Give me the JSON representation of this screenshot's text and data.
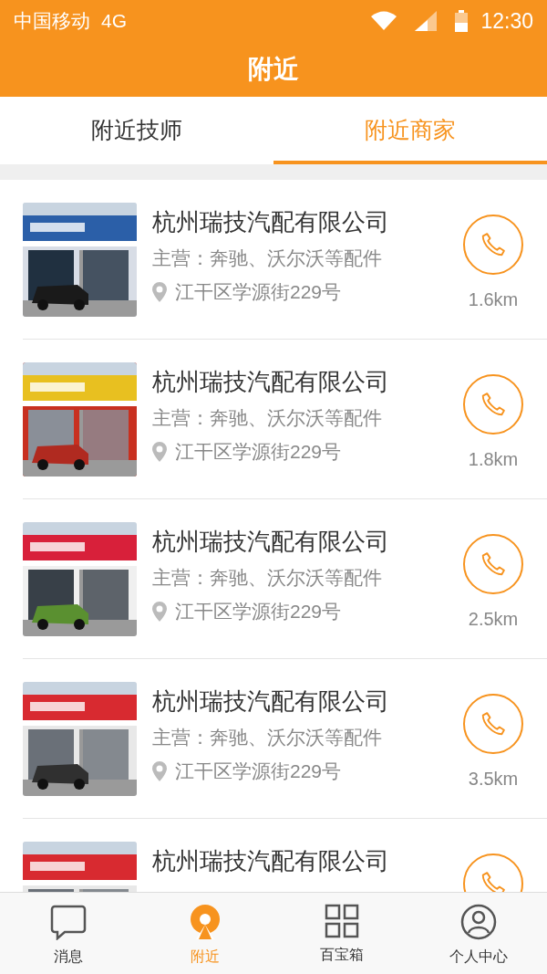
{
  "status_bar": {
    "carrier": "中国移动",
    "network": "4G",
    "time": "12:30"
  },
  "header": {
    "title": "附近"
  },
  "tabs": [
    {
      "label": "附近技师",
      "selected": false
    },
    {
      "label": "附近商家",
      "selected": true
    }
  ],
  "shops": [
    {
      "kind": "picture",
      "name": "杭州瑞技汽配有限公司",
      "business": "主营：奔驰、沃尔沃等配件",
      "address": "江干区学源街229号",
      "distance": "1.6km"
    },
    {
      "kind": "picture",
      "name": "杭州瑞技汽配有限公司",
      "business": "主营：奔驰、沃尔沃等配件",
      "address": "江干区学源街229号",
      "distance": "1.8km"
    },
    {
      "kind": "picture",
      "name": "杭州瑞技汽配有限公司",
      "business": "主营：奔驰、沃尔沃等配件",
      "address": "江干区学源街229号",
      "distance": "2.5km"
    },
    {
      "kind": "picture",
      "name": "杭州瑞技汽配有限公司",
      "business": "主营：奔驰、沃尔沃等配件",
      "address": "江干区学源街229号",
      "distance": "3.5km"
    },
    {
      "kind": "picture",
      "name": "杭州瑞技汽配有限公司"
    }
  ],
  "bottom_nav": [
    {
      "kind": "messages",
      "label": "消息",
      "selected": false
    },
    {
      "kind": "nearby",
      "label": "附近",
      "selected": true
    },
    {
      "kind": "toolbox",
      "label": "百宝箱",
      "selected": false
    },
    {
      "kind": "profile",
      "label": "个人中心",
      "selected": false
    }
  ]
}
